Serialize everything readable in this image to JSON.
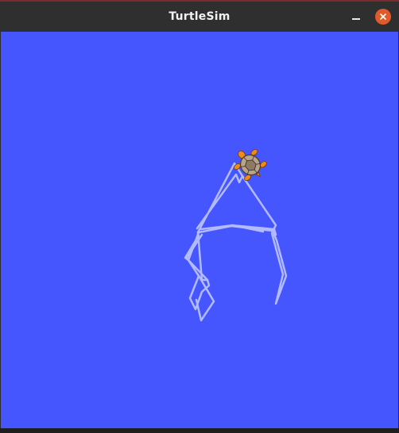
{
  "window": {
    "title": "TurtleSim",
    "controls": {
      "minimize_icon": "minimize-icon",
      "close_icon": "close-icon",
      "close_color": "#e05a2b"
    }
  },
  "canvas": {
    "background_color": "#4556ff",
    "trail_color": "#b3bbff",
    "turtle": {
      "icon": "turtle-icon",
      "shell_color": "#b8a48a",
      "limb_color": "#f08a1c"
    }
  }
}
